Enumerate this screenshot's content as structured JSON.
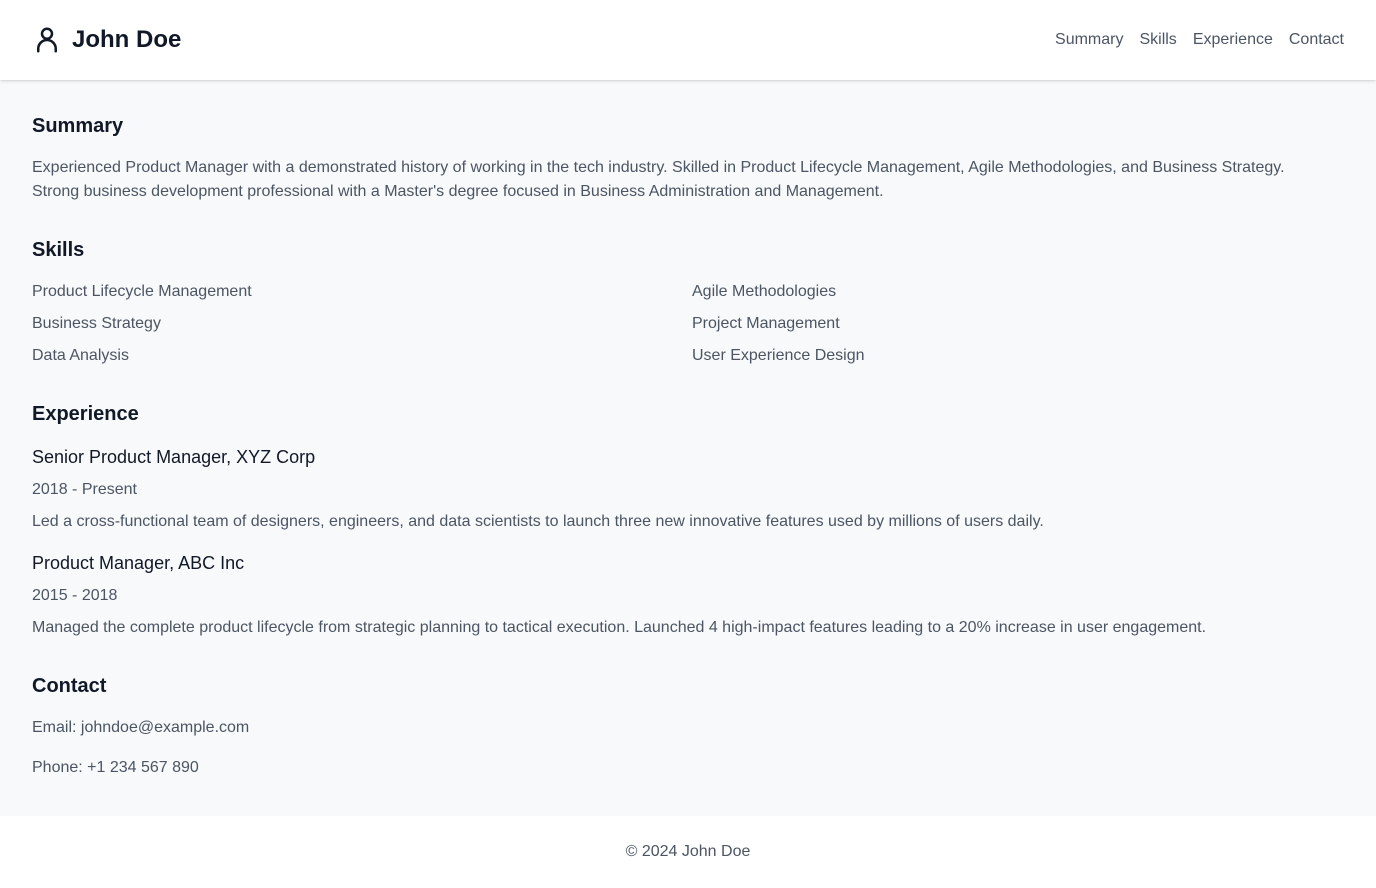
{
  "header": {
    "name": "John Doe",
    "icon": "user-icon",
    "nav": [
      {
        "label": "Summary"
      },
      {
        "label": "Skills"
      },
      {
        "label": "Experience"
      },
      {
        "label": "Contact"
      }
    ]
  },
  "summary": {
    "heading": "Summary",
    "text": "Experienced Product Manager with a demonstrated history of working in the tech industry. Skilled in Product Lifecycle Management, Agile Methodologies, and Business Strategy. Strong business development professional with a Master's degree focused in Business Administration and Management."
  },
  "skills": {
    "heading": "Skills",
    "items": [
      "Product Lifecycle Management",
      "Agile Methodologies",
      "Business Strategy",
      "Project Management",
      "Data Analysis",
      "User Experience Design"
    ]
  },
  "experience": {
    "heading": "Experience",
    "jobs": [
      {
        "title": "Senior Product Manager, XYZ Corp",
        "dates": "2018 - Present",
        "description": "Led a cross-functional team of designers, engineers, and data scientists to launch three new innovative features used by millions of users daily."
      },
      {
        "title": "Product Manager, ABC Inc",
        "dates": "2015 - 2018",
        "description": "Managed the complete product lifecycle from strategic planning to tactical execution. Launched 4 high-impact features leading to a 20% increase in user engagement."
      }
    ]
  },
  "contact": {
    "heading": "Contact",
    "email": "Email: johndoe@example.com",
    "phone": "Phone: +1 234 567 890"
  },
  "footer": {
    "text": "© 2024 John Doe"
  },
  "colors": {
    "background": "#f8f9fa",
    "surface": "#ffffff",
    "heading": "#111827",
    "body_text": "#4b5563"
  }
}
